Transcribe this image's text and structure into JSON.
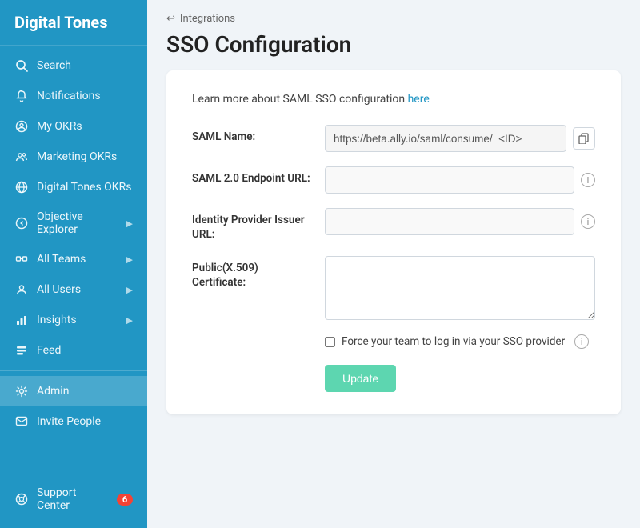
{
  "sidebar": {
    "logo": "Digital Tones",
    "items": [
      {
        "id": "search",
        "label": "Search",
        "icon": "search-icon",
        "chevron": false,
        "active": false
      },
      {
        "id": "notifications",
        "label": "Notifications",
        "icon": "bell-icon",
        "chevron": false,
        "active": false
      },
      {
        "id": "my-okrs",
        "label": "My OKRs",
        "icon": "user-circle-icon",
        "chevron": false,
        "active": false
      },
      {
        "id": "marketing-okrs",
        "label": "Marketing OKRs",
        "icon": "team-icon",
        "chevron": false,
        "active": false
      },
      {
        "id": "digital-tones-okrs",
        "label": "Digital Tones OKRs",
        "icon": "globe-icon",
        "chevron": false,
        "active": false
      },
      {
        "id": "objective-explorer",
        "label": "Objective Explorer",
        "icon": "compass-icon",
        "chevron": true,
        "active": false
      },
      {
        "id": "all-teams",
        "label": "All Teams",
        "icon": "groups-icon",
        "chevron": true,
        "active": false
      },
      {
        "id": "all-users",
        "label": "All Users",
        "icon": "users-icon",
        "chevron": true,
        "active": false
      },
      {
        "id": "insights",
        "label": "Insights",
        "icon": "chart-icon",
        "chevron": true,
        "active": false
      },
      {
        "id": "feed",
        "label": "Feed",
        "icon": "feed-icon",
        "chevron": false,
        "active": false
      }
    ],
    "divider_items": [
      {
        "id": "admin",
        "label": "Admin",
        "icon": "gear-icon",
        "chevron": false,
        "active": true
      },
      {
        "id": "invite-people",
        "label": "Invite People",
        "icon": "invite-icon",
        "chevron": false,
        "active": false
      }
    ],
    "bottom": {
      "id": "support-center",
      "label": "Support Center",
      "icon": "support-icon",
      "badge": "6"
    }
  },
  "breadcrumb": {
    "arrow": "↩",
    "label": "Integrations"
  },
  "page": {
    "title": "SSO Configuration"
  },
  "card": {
    "learn_more_text": "Learn more about SAML SSO configuration ",
    "learn_more_link": "here",
    "form": {
      "saml_name_label": "SAML Name:",
      "saml_name_value": "https://beta.ally.io/saml/consume/  <ID>",
      "saml_endpoint_label": "SAML 2.0 Endpoint URL:",
      "saml_endpoint_value": "",
      "identity_provider_label": "Identity Provider Issuer URL:",
      "identity_provider_value": "",
      "certificate_label": "Public(X.509) Certificate:",
      "certificate_value": "",
      "checkbox_label": "Force your team to log in via your SSO provider",
      "update_button": "Update"
    }
  }
}
